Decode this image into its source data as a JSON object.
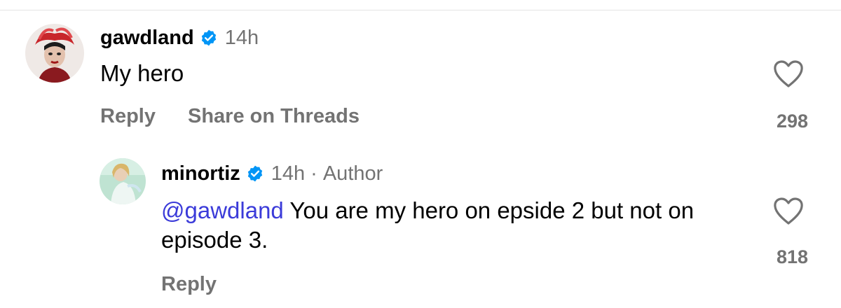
{
  "comments": [
    {
      "username": "gawdland",
      "verified": true,
      "time": "14h",
      "text": "My hero",
      "actions": {
        "reply": "Reply",
        "share": "Share on Threads"
      },
      "likes": "298",
      "avatar_icon": "drag-queen-avatar-red-headpiece"
    },
    {
      "username": "minortiz",
      "verified": true,
      "time": "14h",
      "separator": "·",
      "author_label": "Author",
      "mention": "@gawdland",
      "text": "You are my hero on epside 2 but not on episode 3.",
      "actions": {
        "reply": "Reply"
      },
      "likes": "818",
      "avatar_icon": "performer-avatar-teal-background"
    }
  ],
  "colors": {
    "secondary_text": "#737373",
    "mention": "#3b3bd9",
    "verified_badge": "#0095f6",
    "divider": "#e4e4e4"
  }
}
